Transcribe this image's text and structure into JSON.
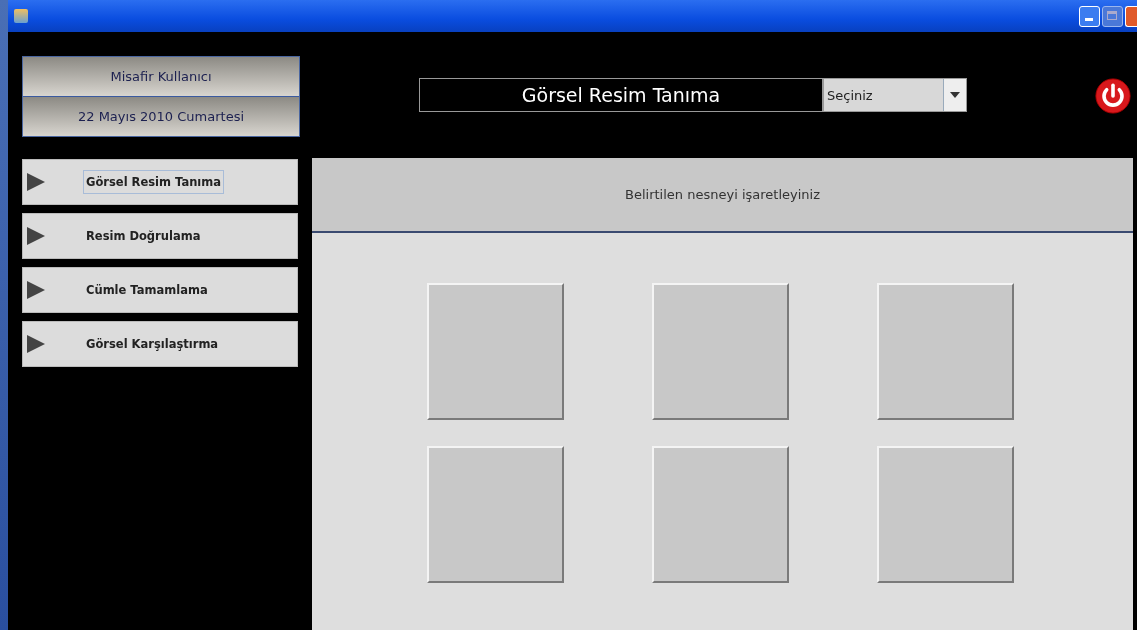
{
  "user_panel": {
    "user_name": "Misafir Kullanıcı",
    "date": "22 Mayıs 2010 Cumartesi"
  },
  "menu": [
    {
      "label": "Görsel Resim Tanıma",
      "focused": true
    },
    {
      "label": "Resim Doğrulama",
      "focused": false
    },
    {
      "label": "Cümle Tamamlama",
      "focused": false
    },
    {
      "label": "Görsel Karşılaştırma",
      "focused": false
    }
  ],
  "module_title": "Görsel Resim Tanıma",
  "dropdown": {
    "value": "Seçiniz"
  },
  "instruction": "Belirtilen nesneyi işaretleyiniz"
}
